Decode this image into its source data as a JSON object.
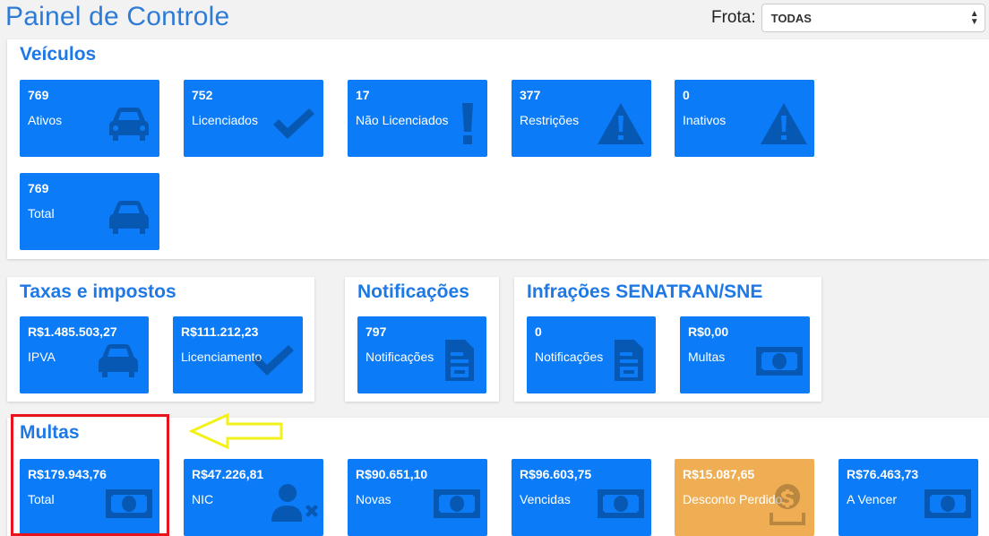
{
  "header": {
    "title": "Painel de Controle",
    "fleet_label": "Frota:",
    "fleet_selected": "TODAS"
  },
  "colors": {
    "card_blue": "#0b7bf7",
    "card_orange": "#efae54",
    "title_blue": "#1e78e6",
    "highlight_red": "#e8131b",
    "arrow_yellow": "#f2f21a"
  },
  "veiculos": {
    "title": "Veículos",
    "cards": [
      {
        "value": "769",
        "label": "Ativos",
        "icon": "car-icon"
      },
      {
        "value": "752",
        "label": "Licenciados",
        "icon": "check-icon"
      },
      {
        "value": "17",
        "label": "Não Licenciados",
        "icon": "exclamation-icon"
      },
      {
        "value": "377",
        "label": "Restrições",
        "icon": "warning-icon"
      },
      {
        "value": "0",
        "label": "Inativos",
        "icon": "warning-icon"
      },
      {
        "value": "769",
        "label": "Total",
        "icon": "car-icon"
      }
    ]
  },
  "taxas": {
    "title": "Taxas e impostos",
    "cards": [
      {
        "value": "R$1.485.503,27",
        "label": "IPVA",
        "icon": "car-icon"
      },
      {
        "value": "R$111.212,23",
        "label": "Licenciamento",
        "icon": "check-icon"
      }
    ]
  },
  "notificacoes": {
    "title": "Notificações",
    "cards": [
      {
        "value": "797",
        "label": "Notificações",
        "icon": "document-icon"
      }
    ]
  },
  "infracoes": {
    "title": "Infrações SENATRAN/SNE",
    "cards": [
      {
        "value": "0",
        "label": "Notificações",
        "icon": "document-icon"
      },
      {
        "value": "R$0,00",
        "label": "Multas",
        "icon": "money-bill-icon"
      }
    ]
  },
  "multas": {
    "title": "Multas",
    "cards": [
      {
        "value": "R$179.943,76",
        "label": "Total",
        "icon": "money-bill-icon"
      },
      {
        "value": "R$47.226,81",
        "label": "NIC",
        "icon": "user-times-icon"
      },
      {
        "value": "R$90.651,10",
        "label": "Novas",
        "icon": "money-bill-icon"
      },
      {
        "value": "R$96.603,75",
        "label": "Vencidas",
        "icon": "money-bill-icon"
      },
      {
        "value": "R$15.087,65",
        "label": "Desconto Perdido",
        "icon": "coin-hand-icon"
      },
      {
        "value": "R$76.463,73",
        "label": "A Vencer",
        "icon": "money-bill-icon"
      }
    ]
  }
}
